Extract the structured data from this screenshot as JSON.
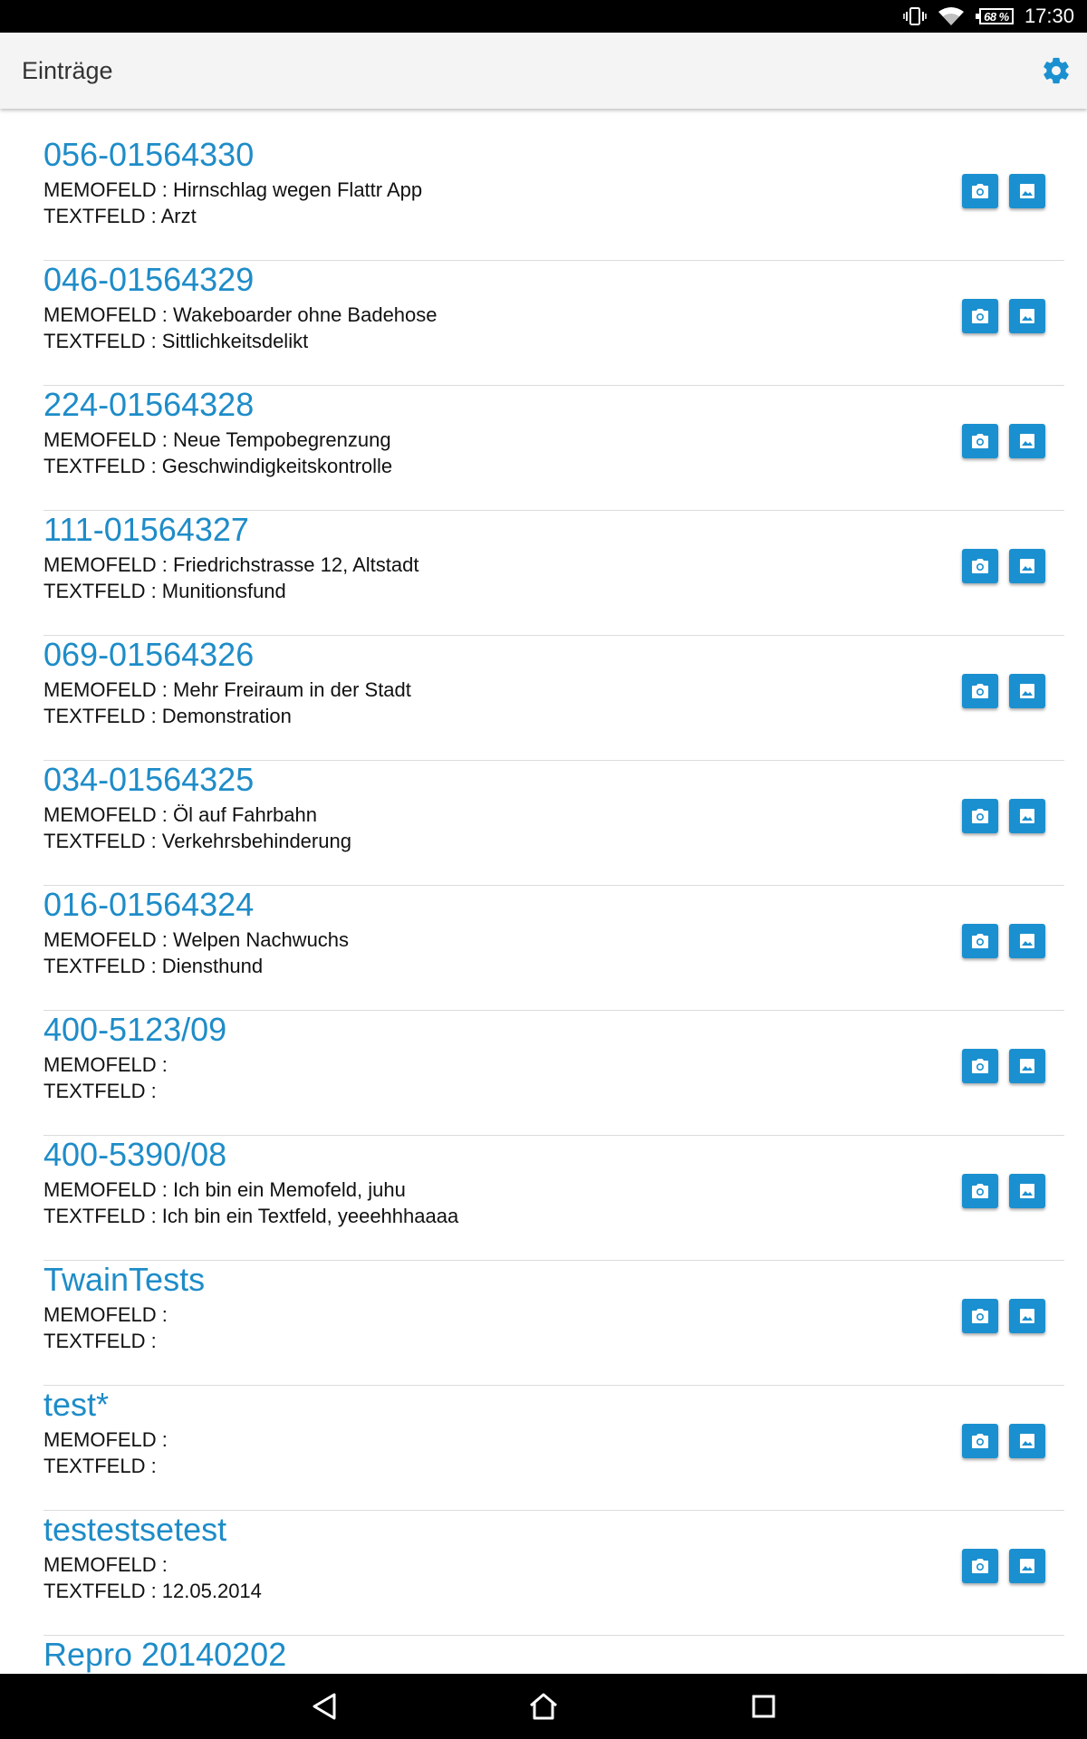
{
  "status_bar": {
    "battery": "68 %",
    "time": "17:30",
    "icons": [
      "vibrate-icon",
      "wifi-icon",
      "battery-icon"
    ]
  },
  "app_bar": {
    "title": "Einträge",
    "settings_icon": "gear-icon"
  },
  "colors": {
    "accent": "#1e8cc8",
    "button": "#1a90d0",
    "appbar_bg": "#f4f4f4"
  },
  "entries": [
    {
      "title": "056-01564330",
      "memo": "MEMOFELD : Hirnschlag wegen Flattr App",
      "text": "TEXTFELD : Arzt"
    },
    {
      "title": "046-01564329",
      "memo": "MEMOFELD : Wakeboarder ohne Badehose",
      "text": "TEXTFELD : Sittlichkeitsdelikt"
    },
    {
      "title": "224-01564328",
      "memo": "MEMOFELD : Neue Tempobegrenzung",
      "text": "TEXTFELD : Geschwindigkeitskontrolle"
    },
    {
      "title": "111-01564327",
      "memo": "MEMOFELD : Friedrichstrasse 12, Altstadt",
      "text": "TEXTFELD : Munitionsfund"
    },
    {
      "title": "069-01564326",
      "memo": "MEMOFELD : Mehr Freiraum in der Stadt",
      "text": "TEXTFELD : Demonstration"
    },
    {
      "title": "034-01564325",
      "memo": "MEMOFELD : Öl auf Fahrbahn",
      "text": "TEXTFELD : Verkehrsbehinderung"
    },
    {
      "title": "016-01564324",
      "memo": "MEMOFELD : Welpen Nachwuchs",
      "text": "TEXTFELD : Diensthund"
    },
    {
      "title": "400-5123/09",
      "memo": "MEMOFELD :",
      "text": "TEXTFELD :"
    },
    {
      "title": "400-5390/08",
      "memo": "MEMOFELD : Ich bin ein Memofeld, juhu",
      "text": "TEXTFELD : Ich bin ein Textfeld, yeeehhhaaaa"
    },
    {
      "title": "TwainTests",
      "memo": "MEMOFELD :",
      "text": "TEXTFELD :"
    },
    {
      "title": "test*",
      "memo": "MEMOFELD :",
      "text": "TEXTFELD :"
    },
    {
      "title": "testestsetest",
      "memo": "MEMOFELD :",
      "text": "TEXTFELD : 12.05.2014"
    },
    {
      "title": "Repro 20140202",
      "memo": "",
      "text": ""
    }
  ],
  "entry_buttons": [
    "camera-icon",
    "gallery-icon"
  ],
  "nav_bar": [
    "back-icon",
    "home-icon",
    "recents-icon"
  ]
}
